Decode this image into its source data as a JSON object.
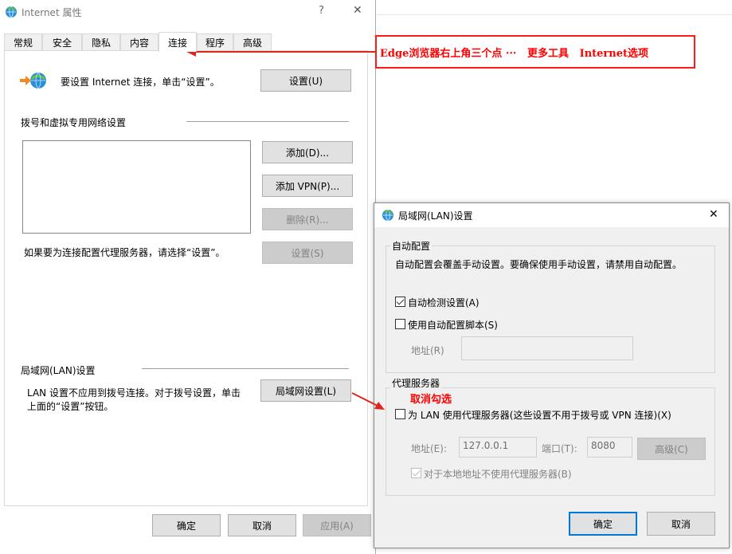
{
  "internet_props": {
    "title": "Internet 属性",
    "help": "?",
    "close": "✕",
    "tabs": [
      "常规",
      "安全",
      "隐私",
      "内容",
      "连接",
      "程序",
      "高级"
    ],
    "setup_text": "要设置 Internet 连接，单击“设置”。",
    "setup_button": "设置(U)",
    "dialup_header": "拨号和虚拟专用网络设置",
    "add_button": "添加(D)...",
    "add_vpn_button": "添加 VPN(P)...",
    "remove_button": "删除(R)...",
    "proxy_hint": "如果要为连接配置代理服务器，请选择“设置”。",
    "settings_button": "设置(S)",
    "lan_header": "局域网(LAN)设置",
    "lan_text_1": "LAN 设置不应用到拨号连接。对于拨号设置，单击",
    "lan_text_2": "上面的“设置”按钮。",
    "lan_button": "局域网设置(L)",
    "ok": "确定",
    "cancel": "取消",
    "apply": "应用(A)"
  },
  "annotation": {
    "text": "Edge浏览器右上角三个点 ···   更多工具   Internet选项",
    "proxy_note": "取消勾选",
    "color": "#ff0000"
  },
  "lan_dialog": {
    "title": "局域网(LAN)设置",
    "close": "✕",
    "auto_config_header": "自动配置",
    "auto_config_desc": "自动配置会覆盖手动设置。要确保使用手动设置，请禁用自动配置。",
    "auto_detect_label": "自动检测设置(A)",
    "auto_detect_checked": true,
    "use_script_label": "使用自动配置脚本(S)",
    "use_script_checked": false,
    "address_label": "地址(R)",
    "proxy_header": "代理服务器",
    "use_proxy_label": "为 LAN 使用代理服务器(这些设置不用于拨号或 VPN 连接)(X)",
    "use_proxy_checked": false,
    "proxy_address_label": "地址(E):",
    "proxy_address_value": "127.0.0.1",
    "port_label": "端口(T):",
    "port_value": "8080",
    "advanced_button": "高级(C)",
    "bypass_label": "对于本地地址不使用代理服务器(B)",
    "bypass_checked": true,
    "ok": "确定",
    "cancel": "取消"
  }
}
